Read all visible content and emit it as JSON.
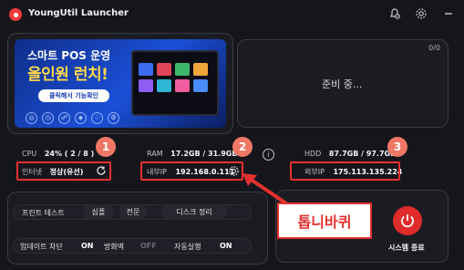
{
  "app": {
    "title": "YoungUtil Launcher"
  },
  "titlebar": {
    "icons": [
      "bell-off-icon",
      "gear-icon",
      "minimize-icon"
    ]
  },
  "banner": {
    "line1": "스마트 POS 운영",
    "line2": "올인원 런치!",
    "button": "클릭해서 기능확인"
  },
  "ready": {
    "counter": "0/0",
    "status": "준비 중..."
  },
  "stats": {
    "cpu_label": "CPU",
    "cpu_value": "24% ( 2 / 8 )",
    "ram_label": "RAM",
    "ram_value": "17.2GB / 31.9GB",
    "hdd_label": "HDD",
    "hdd_value": "87.7GB / 97.7GB",
    "internet_label": "인터넷",
    "internet_value": "정상(유선)",
    "internal_ip_label": "내부IP",
    "internal_ip_value": "192.168.0.111",
    "external_ip_label": "외부IP",
    "external_ip_value": "175.113.135.224"
  },
  "annotations": {
    "n1": "1",
    "n2": "2",
    "n3": "3",
    "callout": "톱니바퀴"
  },
  "controls": {
    "print_test": "프린트 테스트",
    "simple": "심플",
    "full": "전문",
    "disk_cleanup": "디스크 정리",
    "update_block": "업데이트 차단",
    "update_block_state": "ON",
    "firewall": "방화벽",
    "firewall_state": "OFF",
    "autorun": "자동실행",
    "autorun_state": "ON"
  },
  "power": {
    "label": "시스템 종료",
    "color": "#e02b2b"
  },
  "colors": {
    "annotation_red": "#e4312f",
    "badge": "#f07766",
    "banner_blue": "#1b4fd6"
  }
}
